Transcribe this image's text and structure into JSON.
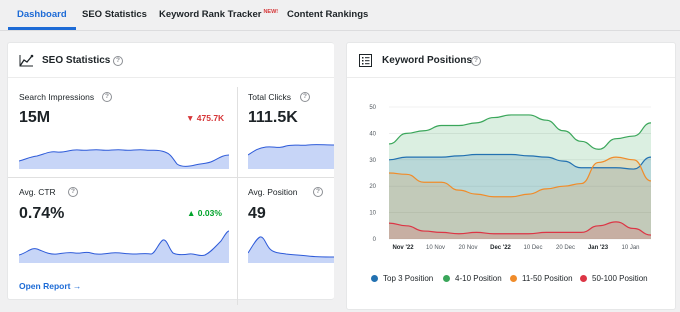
{
  "tabs": [
    {
      "label": "Dashboard",
      "active": true
    },
    {
      "label": "SEO Statistics",
      "active": false
    },
    {
      "label": "Keyword Rank Tracker",
      "active": false,
      "badge": "NEW!"
    },
    {
      "label": "Content Rankings",
      "active": false
    }
  ],
  "seo_card": {
    "title": "SEO Statistics",
    "metrics": [
      {
        "label": "Search Impressions",
        "value": "15M",
        "change": "475.7K",
        "direction": "down"
      },
      {
        "label": "Total Clicks",
        "value": "111.5K"
      },
      {
        "label": "Avg. CTR",
        "value": "0.74%",
        "change": "0.03%",
        "direction": "up"
      },
      {
        "label": "Avg. Position",
        "value": "49"
      }
    ],
    "link": "Open Report →"
  },
  "kw_card": {
    "title": "Keyword Positions",
    "legend": [
      {
        "label": "Top 3 Position",
        "color": "#2271b1"
      },
      {
        "label": "4-10 Position",
        "color": "#3aa65a"
      },
      {
        "label": "11-50 Position",
        "color": "#f08c2a"
      },
      {
        "label": "50-100 Position",
        "color": "#dc3545"
      }
    ]
  },
  "chart_data": {
    "type": "area",
    "ylim": [
      0,
      50
    ],
    "y_ticks": [
      "50",
      "40",
      "30",
      "20",
      "10",
      "0"
    ],
    "x_ticks": [
      "Nov '22",
      "10 Nov",
      "20 Nov",
      "Dec '22",
      "10 Dec",
      "20 Dec",
      "Jan '23",
      "10 Jan"
    ],
    "x_ticks_bold": [
      true,
      false,
      false,
      true,
      false,
      false,
      true,
      false
    ],
    "series": [
      {
        "name": "Top 3 Position",
        "color": "#2271b1",
        "values": [
          30,
          31,
          31,
          31,
          31.5,
          32,
          32,
          32,
          31.5,
          31,
          29.5,
          27,
          27,
          27,
          26.5,
          31
        ]
      },
      {
        "name": "4-10 Position",
        "color": "#3aa65a",
        "values": [
          36,
          40,
          41,
          43,
          43,
          44,
          46,
          47,
          47,
          45,
          41,
          37,
          34,
          38,
          39,
          44
        ]
      },
      {
        "name": "11-50 Position",
        "color": "#f08c2a",
        "values": [
          25,
          24.5,
          21.5,
          21.5,
          18.5,
          17,
          16,
          16,
          17,
          19,
          20,
          21,
          29,
          31,
          30,
          22
        ]
      },
      {
        "name": "50-100 Position",
        "color": "#dc3545",
        "values": [
          6,
          5,
          3,
          2.5,
          2,
          2.5,
          2,
          2,
          2,
          2.5,
          2.5,
          2.5,
          5,
          6.5,
          4,
          1.5
        ]
      }
    ]
  },
  "icons": {
    "seo": "trend-chart-icon",
    "kw": "list-icon",
    "help": "question-circle-icon"
  }
}
